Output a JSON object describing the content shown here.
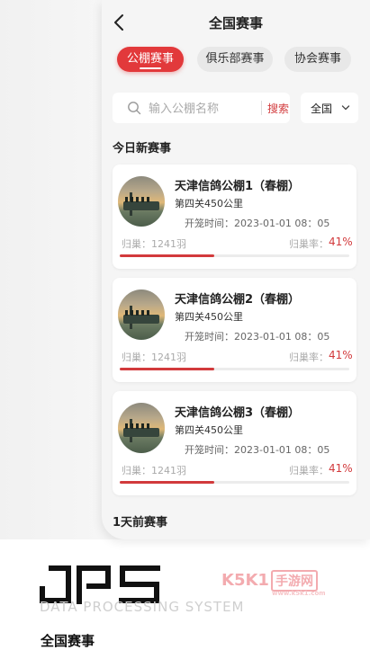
{
  "header": {
    "title": "全国赛事"
  },
  "tabs": [
    {
      "label": "公棚赛事",
      "active": true
    },
    {
      "label": "俱乐部赛事",
      "active": false
    },
    {
      "label": "协会赛事",
      "active": false
    }
  ],
  "search": {
    "placeholder": "输入公棚名称",
    "value": "",
    "button_label": "搜索"
  },
  "region": {
    "selected": "全国"
  },
  "sections": {
    "today": "今日新赛事",
    "previous": "1天前赛事"
  },
  "races": [
    {
      "title": "天津信鸽公棚1（春棚）",
      "stage": "第四关450公里",
      "start_label": "开笼时间：",
      "start_time": "2023-01-01 08：05",
      "return_label": "归巢：",
      "return_count": "1241羽",
      "rate_label": "归巢率：",
      "rate": "41%",
      "rate_fraction": 0.41
    },
    {
      "title": "天津信鸽公棚2（春棚）",
      "stage": "第四关450公里",
      "start_label": "开笼时间：",
      "start_time": "2023-01-01 08：05",
      "return_label": "归巢：",
      "return_count": "1241羽",
      "rate_label": "归巢率：",
      "rate": "41%",
      "rate_fraction": 0.41
    },
    {
      "title": "天津信鸽公棚3（春棚）",
      "stage": "第四关450公里",
      "start_label": "开笼时间：",
      "start_time": "2023-01-01 08：05",
      "return_label": "归巢：",
      "return_count": "1241羽",
      "rate_label": "归巢率：",
      "rate": "41%",
      "rate_fraction": 0.41
    }
  ],
  "branding": {
    "tagline": "DATA PROCESSING SYSTEM",
    "watermark_main": "K5K1",
    "watermark_boxed": "手游网",
    "watermark_sub": "www.k5k1.com"
  },
  "caption": "全国赛事",
  "colors": {
    "accent": "#e2393b",
    "rate_text": "#d23a3c"
  },
  "icons": {
    "back": "chevron-left-icon",
    "search": "search-icon",
    "dropdown": "chevron-down-icon"
  }
}
